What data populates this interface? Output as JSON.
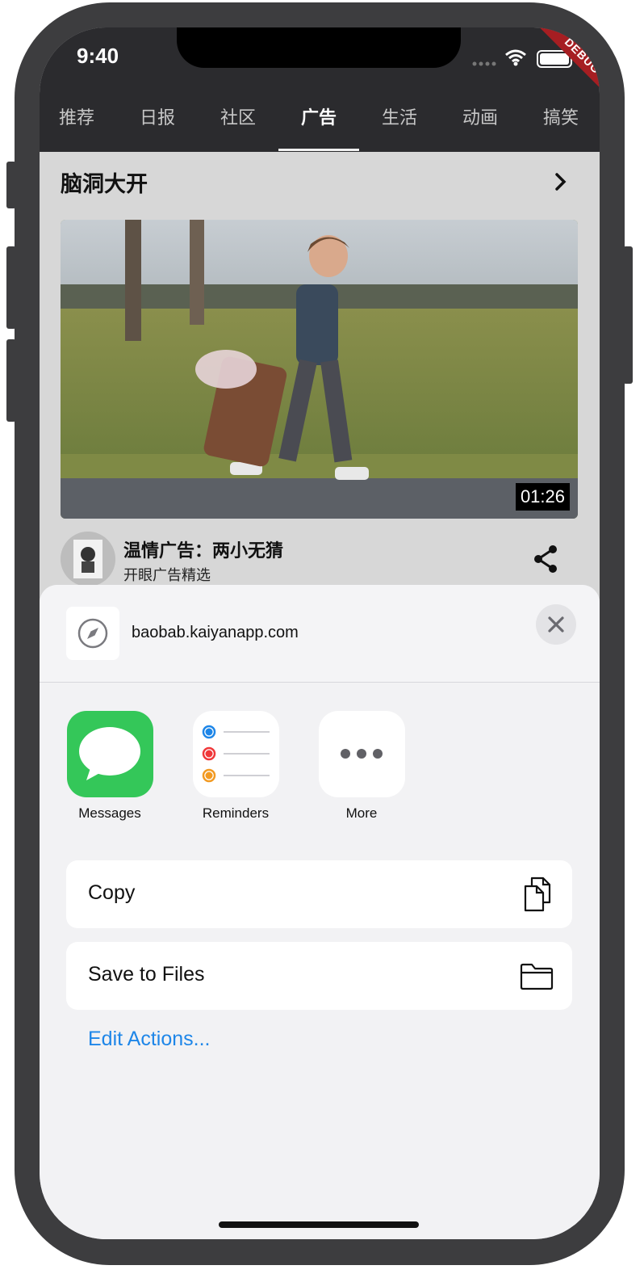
{
  "status_bar": {
    "time": "9:40",
    "debug_banner": "DEBUG"
  },
  "tabs": [
    {
      "label": "推荐"
    },
    {
      "label": "日报"
    },
    {
      "label": "社区"
    },
    {
      "label": "广告"
    },
    {
      "label": "生活"
    },
    {
      "label": "动画"
    },
    {
      "label": "搞笑"
    }
  ],
  "section": {
    "title": "脑洞大开"
  },
  "video": {
    "duration": "01:26",
    "title": "温情广告：两小无猜",
    "subtitle": "开眼广告精选"
  },
  "share_sheet": {
    "url": "baobab.kaiyanapp.com",
    "apps": [
      {
        "label": "Messages",
        "icon": "messages-icon"
      },
      {
        "label": "Reminders",
        "icon": "reminders-icon"
      },
      {
        "label": "More",
        "icon": "more-icon"
      }
    ],
    "actions": [
      {
        "label": "Copy",
        "icon": "copy-icon"
      },
      {
        "label": "Save to Files",
        "icon": "folder-icon"
      }
    ],
    "edit_actions": "Edit Actions..."
  },
  "colors": {
    "header_bg": "#2b2b2e",
    "accent_blue": "#1e86e8",
    "messages_green": "#34c759",
    "debug_red": "#a61e22"
  }
}
